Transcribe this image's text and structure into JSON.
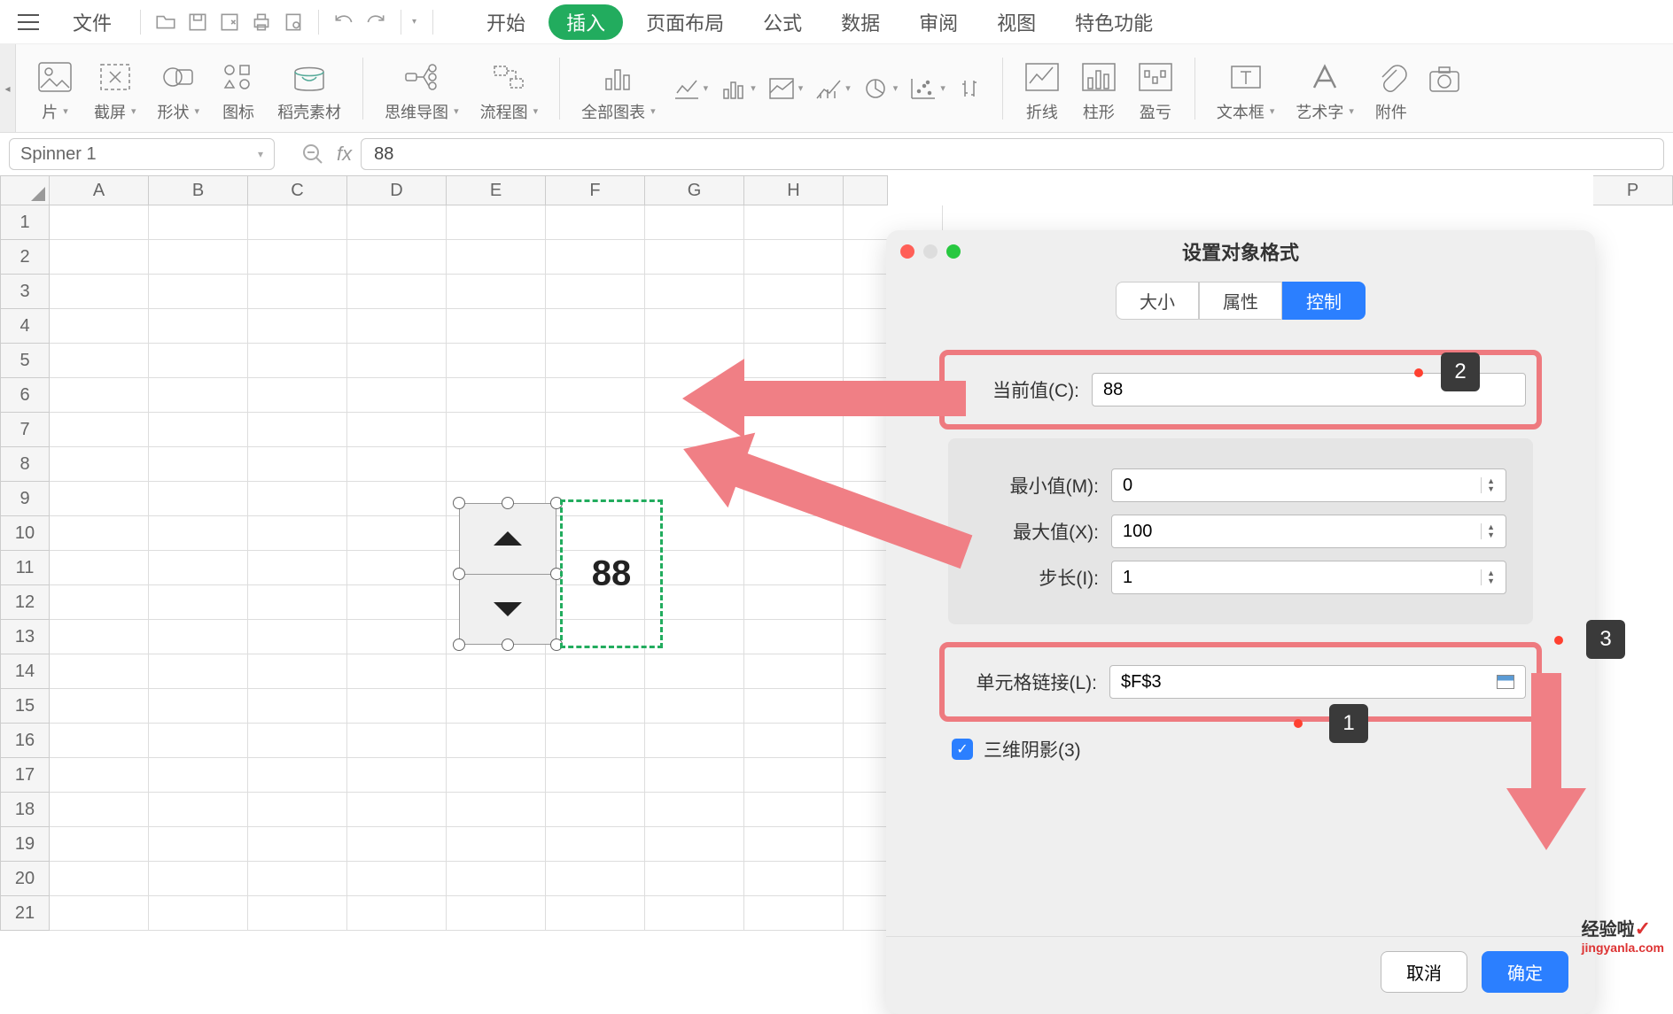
{
  "menu": {
    "file": "文件",
    "items": [
      "开始",
      "插入",
      "页面布局",
      "公式",
      "数据",
      "审阅",
      "视图",
      "特色功能"
    ],
    "active_index": 1
  },
  "ribbon": {
    "picture_suffix": "片",
    "screenshot": "截屏",
    "shape": "形状",
    "icons": "图标",
    "dock_assets": "稻壳素材",
    "mindmap": "思维导图",
    "flowchart": "流程图",
    "all_charts": "全部图表",
    "sparkline_line": "折线",
    "sparkline_bar": "柱形",
    "sparkline_winloss": "盈亏",
    "textbox": "文本框",
    "wordart": "艺术字",
    "attachment": "附件"
  },
  "namebox": "Spinner 1",
  "formula_value": "88",
  "linked_cell_value": "88",
  "columns": [
    "A",
    "B",
    "C",
    "D",
    "E",
    "F",
    "G",
    "H",
    "P"
  ],
  "row_count": 21,
  "dialog": {
    "title": "设置对象格式",
    "tabs": [
      "大小",
      "属性",
      "控制"
    ],
    "active_tab": 2,
    "current_label": "当前值(C):",
    "current_value": "88",
    "min_label": "最小值(M):",
    "min_value": "0",
    "max_label": "最大值(X):",
    "max_value": "100",
    "step_label": "步长(I):",
    "step_value": "1",
    "link_label": "单元格链接(L):",
    "link_value": "$F$3",
    "shadow_label": "三维阴影(3)",
    "cancel": "取消",
    "ok": "确定"
  },
  "callouts": {
    "c1": "1",
    "c2": "2",
    "c3": "3"
  },
  "watermark": {
    "cn": "经验啦",
    "en": "jingyanla.com"
  }
}
